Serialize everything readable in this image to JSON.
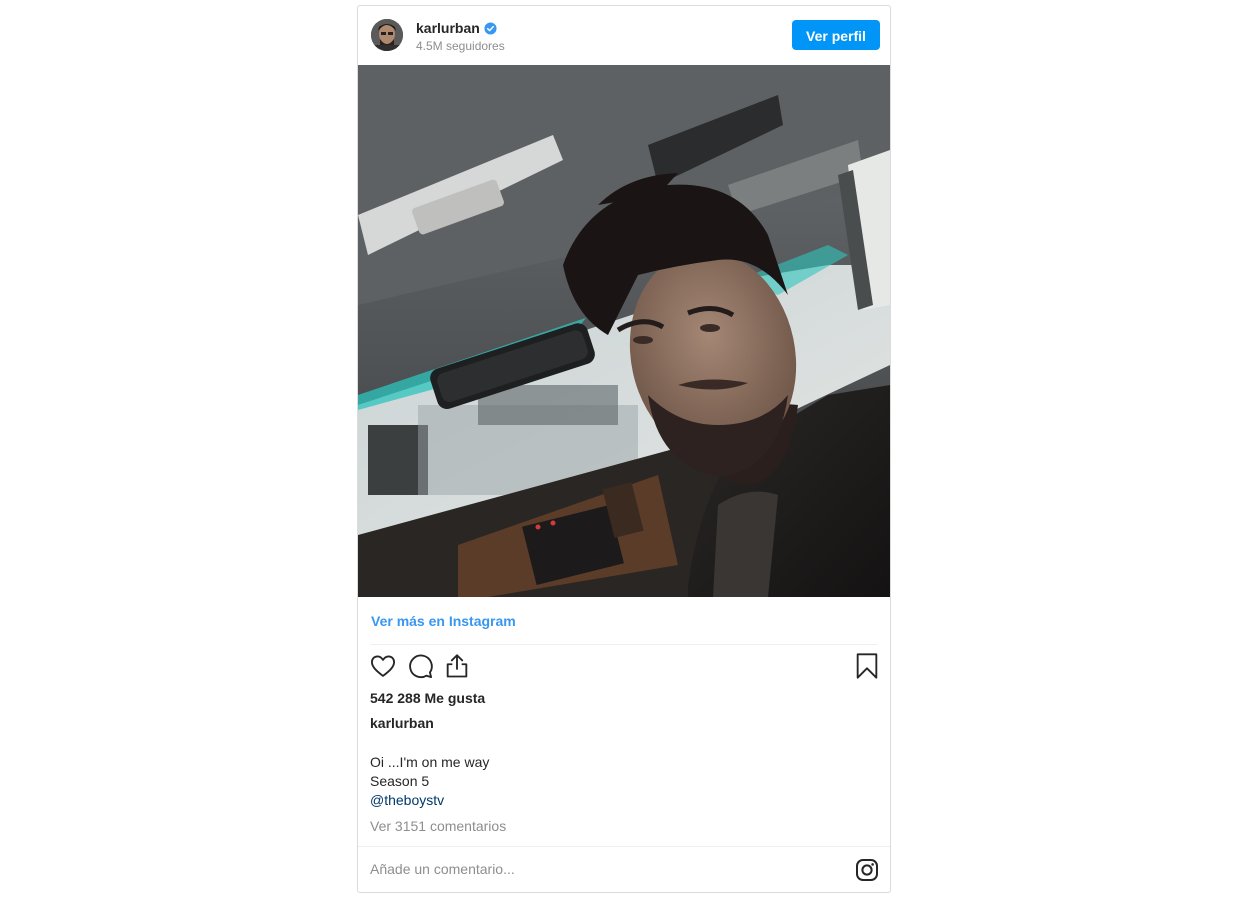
{
  "header": {
    "username": "karlurban",
    "followers": "4.5M seguidores",
    "view_profile_label": "Ver perfil",
    "verified": true
  },
  "post": {
    "more_link": "Ver más en Instagram",
    "likes": "542 288 Me gusta",
    "caption_user": "karlurban",
    "caption_lines": [
      "Oi ...I'm on me way",
      "Season 5"
    ],
    "mention": "@theboystv",
    "view_comments": "Ver 3151 comentarios"
  },
  "footer": {
    "comment_placeholder": "Añade un comentario..."
  },
  "icons": {
    "like": "heart-icon",
    "comment": "comment-bubble-icon",
    "share": "share-icon",
    "save": "bookmark-icon",
    "instagram": "instagram-logo-icon",
    "verified": "verified-badge-icon"
  },
  "colors": {
    "accent": "#0095f6",
    "link": "#3897f0",
    "muted": "#8e8e8e",
    "border": "#dbdbdb"
  }
}
